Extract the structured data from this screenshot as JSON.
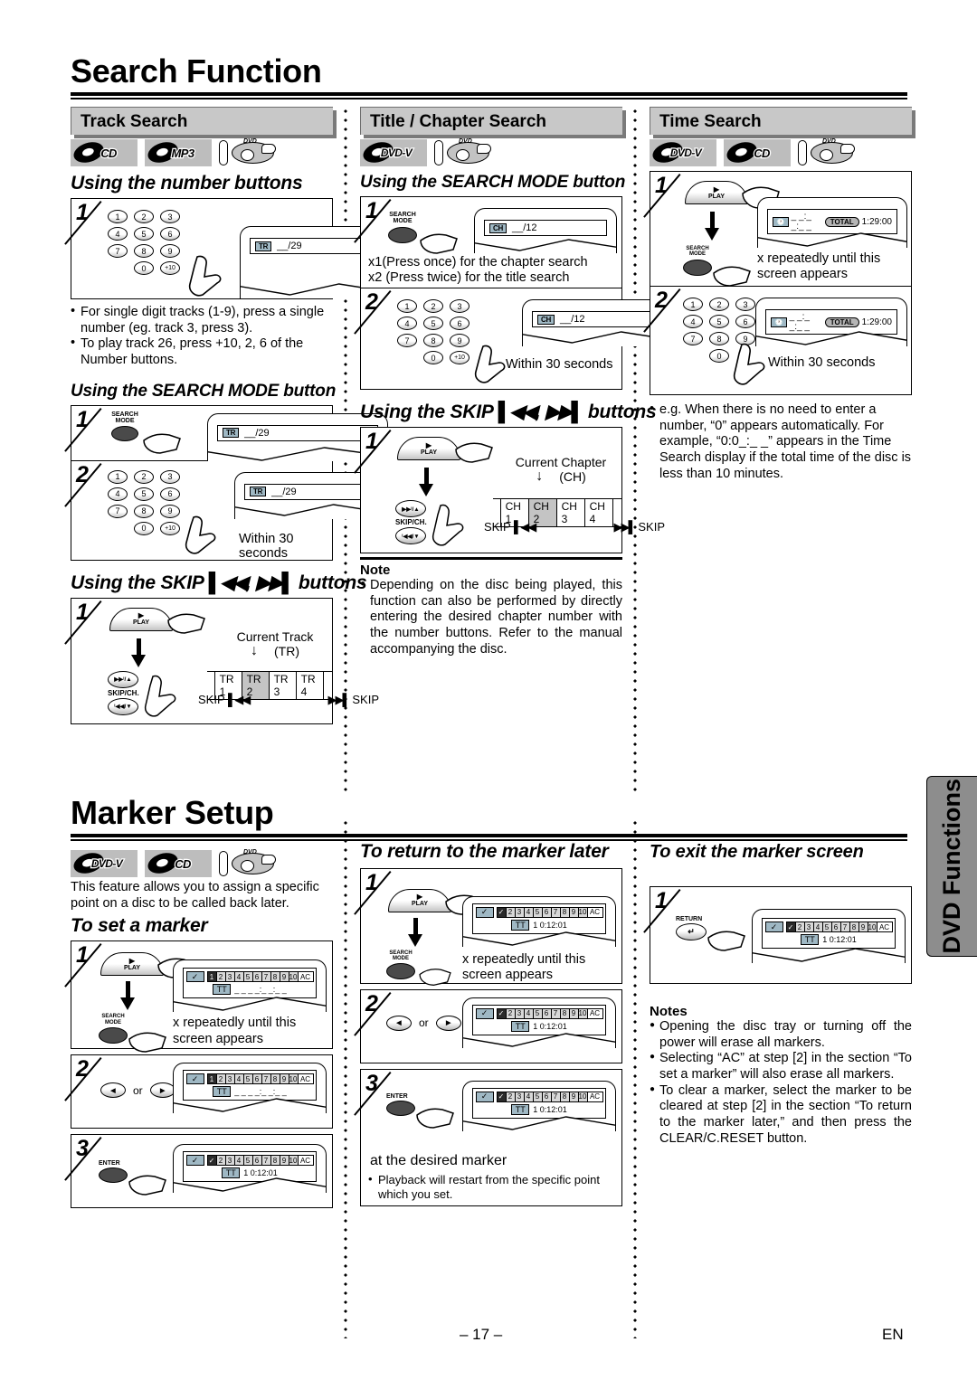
{
  "page": {
    "title": "Search Function",
    "second_title": "Marker Setup",
    "side_tab": "DVD Functions",
    "page_number": "– 17 –",
    "language_code": "EN"
  },
  "sections": {
    "track_search": {
      "heading": "Track Search",
      "badges": [
        "CD",
        "MP3",
        "dvd-disc-logo"
      ],
      "sub1": "Using the number buttons",
      "sub2": "Using the SEARCH MODE button",
      "sub3": "Using the SKIP ᴵ◀◀ , ▶▶ᴵ buttons",
      "sub3_pre": "Using the SKIP",
      "sub3_mid": ",",
      "sub3_post": "buttons",
      "display_tag": "TR",
      "display_value": "__/29",
      "bullets": [
        "For single digit tracks (1-9), press a single number (eg. track 3, press 3).",
        "To play track 26, press +10, 2, 6 of the Number buttons."
      ],
      "within": "Within 30 seconds",
      "current_label": "Current Track",
      "current_abbr": "(TR)",
      "strip": [
        "TR 1",
        "TR 2",
        "TR 3",
        "TR 4"
      ],
      "strip_current": "TR 2",
      "skip_left": "SKIP",
      "skip_right": "SKIP"
    },
    "title_chapter_search": {
      "heading": "Title / Chapter Search",
      "badges": [
        "DVD-V",
        "dvd-disc-logo"
      ],
      "sub1": "Using the SEARCH MODE button",
      "sub2_pre": "Using the SKIP",
      "sub2_mid": ",",
      "sub2_post": "buttons",
      "display_tag": "CH",
      "display_value": "__/12",
      "press_lines": [
        "x1(Press once) for the chapter search",
        "x2 (Press twice) for the title search"
      ],
      "within": "Within 30 seconds",
      "current_label": "Current Chapter",
      "current_abbr": "(CH)",
      "strip": [
        "CH 1",
        "CH 2",
        "CH 3",
        "CH 4"
      ],
      "strip_current": "CH 2",
      "skip_left": "SKIP",
      "skip_right": "SKIP",
      "note_head": "Note",
      "note_body": "Depending on the disc being played, this function can also be performed by directly entering the desired chapter number with the number buttons. Refer to the manual accompanying the disc."
    },
    "time_search": {
      "heading": "Time Search",
      "badges": [
        "DVD-V",
        "CD",
        "dvd-disc-logo"
      ],
      "display_time_blank": "_ _:_ _:_ _",
      "display_total_label": "TOTAL",
      "display_total_value": "1:29:00",
      "step1_text": "x repeatedly until this screen appears",
      "step2_text": "Within 30 seconds",
      "bullets": [
        "e.g. When there is no need to enter a number, “0” appears automatically. For example, “0:0_:_ _” appears in the Time Search display if the total time of the disc is less than 10 minutes."
      ]
    },
    "marker_setup": {
      "heading": "Marker Setup",
      "badges": [
        "DVD-V",
        "CD",
        "dvd-disc-logo"
      ],
      "intro": "This feature allows you to assign a specific point on a disc to be called back later.",
      "to_set": {
        "title": "To set a marker",
        "step1_text": "x repeatedly until this screen appears",
        "step2_or": "or",
        "marker_numbers": [
          "1",
          "2",
          "3",
          "4",
          "5",
          "6",
          "7",
          "8",
          "9",
          "10"
        ],
        "marker_ac": "AC",
        "marker_tag": "TT",
        "marker_time_blank": "_ _ _ _:_ _:_ _"
      },
      "to_return": {
        "title": "To return to the marker later",
        "step1_text": "x repeatedly until this screen appears",
        "step2_or": "or",
        "step3_text": "at the desired marker",
        "step3_bullet": "Playback will restart from the specific point which you set.",
        "marker_tag": "TT",
        "marker_time": "1  0:12:01"
      },
      "to_exit": {
        "title": "To exit the marker screen",
        "button_label": "RETURN",
        "marker_tag": "TT",
        "marker_time": "1  0:12:01"
      },
      "notes_head": "Notes",
      "notes": [
        "Opening the disc tray or turning off the power will erase all markers.",
        "Selecting “AC” at step [2] in the section “To set a marker” will also erase all markers.",
        "To clear a marker, select the marker to be cleared at step [2] in the section “To return to the marker later,”  and then press the CLEAR/C.RESET button."
      ]
    }
  },
  "buttons": {
    "play": "PLAY",
    "search_mode_l1": "SEARCH",
    "search_mode_l2": "MODE",
    "skip_ch": "SKIP/CH.",
    "skip_up": "▶▶ᴵ/▲",
    "skip_down": "ᴵ◀◀/▼",
    "enter": "ENTER",
    "return": "RETURN",
    "plus10": "+10"
  },
  "keypad": {
    "rows": [
      [
        "1",
        "2",
        "3"
      ],
      [
        "4",
        "5",
        "6"
      ],
      [
        "7",
        "8",
        "9"
      ]
    ],
    "bottom": [
      "0",
      "+10"
    ]
  },
  "colors": {
    "section_bar": "#c8c8c8",
    "badge_bg": "#bdbdbd",
    "tag_blue": "#9fb8c4",
    "side_tab": "#8d8d8d",
    "highlight": "#c4c4c4"
  }
}
